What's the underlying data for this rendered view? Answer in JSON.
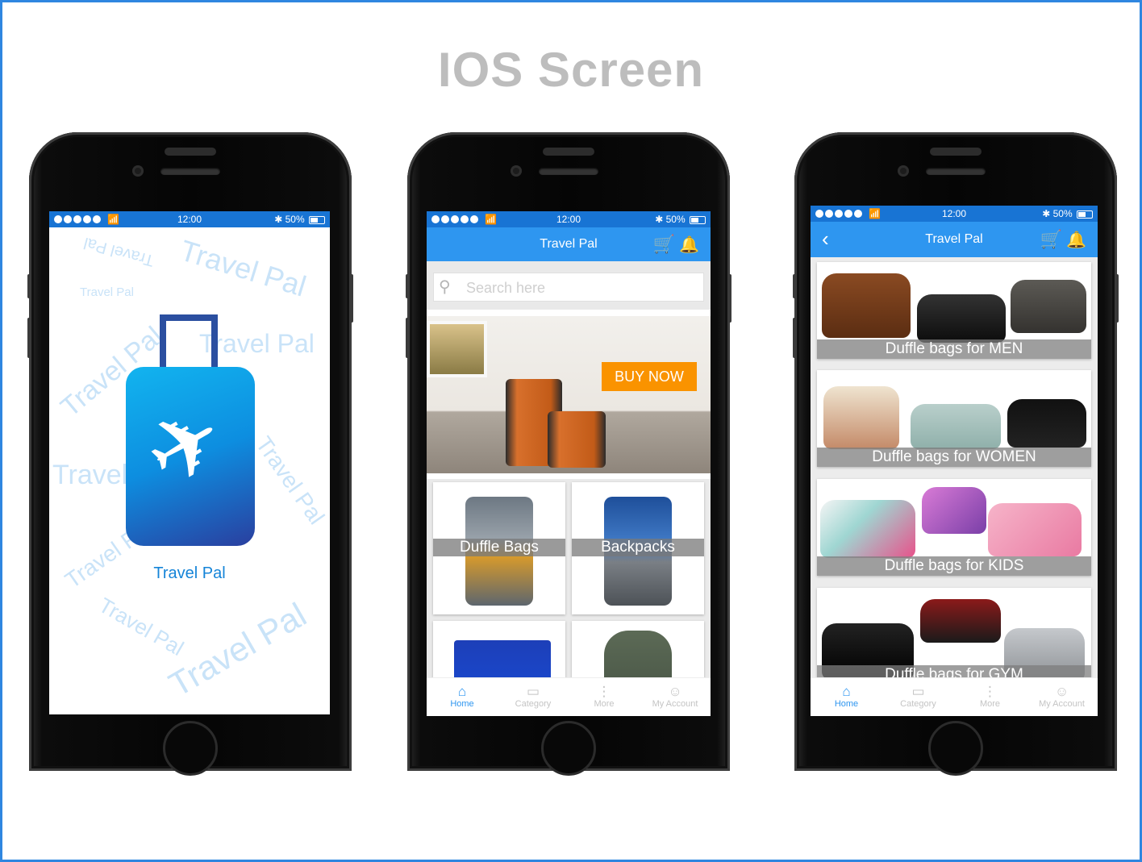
{
  "page_title": "IOS Screen",
  "status": {
    "time": "12:00",
    "battery": "50%",
    "bluetooth": "✱"
  },
  "splash": {
    "brand": "Travel Pal",
    "watermarks": [
      "Travel Pal",
      "Travel Pal",
      "Travel Pal",
      "Travel Pal",
      "Travel Pal",
      "Travel",
      "Travel Pal",
      "Travel F",
      "Travel Pal",
      "Travel Pal"
    ]
  },
  "home": {
    "title": "Travel Pal",
    "search_placeholder": "Search here",
    "banner_button": "BUY NOW",
    "categories": [
      "Duffle Bags",
      "Backpacks",
      "",
      ""
    ]
  },
  "category": {
    "title": "Travel Pal",
    "items": [
      "Duffle bags for MEN",
      "Duffle bags for WOMEN",
      "Duffle bags for KIDS",
      "Duffle bags for GYM"
    ]
  },
  "tabs": [
    "Home",
    "Category",
    "More",
    "My Account"
  ],
  "colors": {
    "accent": "#2e96f0",
    "status_bar": "#1874d4",
    "buy_now": "#fa9300",
    "title_gray": "#bdbdbd"
  }
}
